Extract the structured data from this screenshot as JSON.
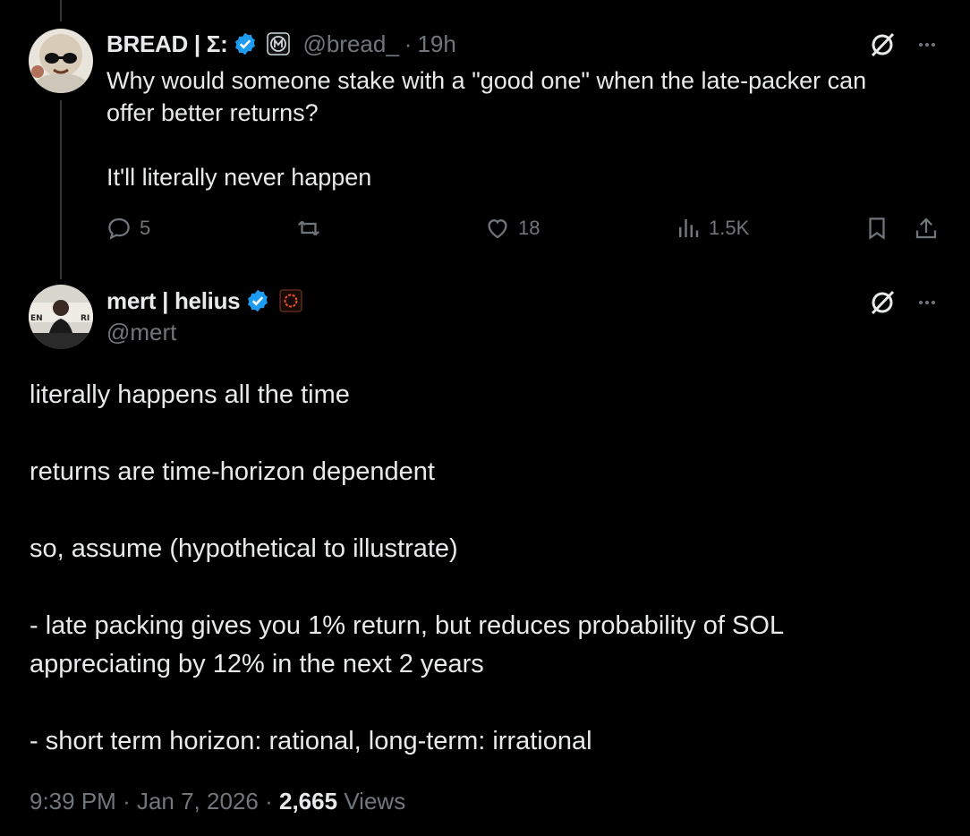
{
  "reply_tweet": {
    "display_name": "BREAD | Σ:",
    "handle": "@bread_",
    "separator": "·",
    "time": "19h",
    "text_lines": [
      "Why would someone stake with a \"good one\" when the late-packer can",
      "offer better returns?",
      "It'll literally never happen"
    ],
    "stats": {
      "replies": "5",
      "reposts": "",
      "likes": "18",
      "views": "1.5K"
    },
    "icons": [
      "reply-icon",
      "repost-icon",
      "like-icon",
      "views-icon",
      "bookmark-icon",
      "share-icon",
      "grok-icon",
      "more-icon"
    ]
  },
  "main_tweet": {
    "display_name": "mert | helius",
    "handle": "@mert",
    "paragraphs": [
      "literally happens all the time",
      "returns are time-horizon dependent",
      "so, assume (hypothetical to illustrate)",
      "- late packing gives you 1% return, but reduces probability of SOL appreciating by 12% in the next 2 years",
      "- short term horizon: rational, long-term: irrational"
    ],
    "meta": {
      "time": "9:39 PM",
      "separator": "·",
      "date": "Jan 7, 2026",
      "views_count": "2,665",
      "views_label": "Views"
    }
  },
  "colors": {
    "background": "#000000",
    "text": "#e7e9ea",
    "secondary": "#71767b",
    "verified": "#1d9bf0",
    "thread_line": "#333639"
  }
}
